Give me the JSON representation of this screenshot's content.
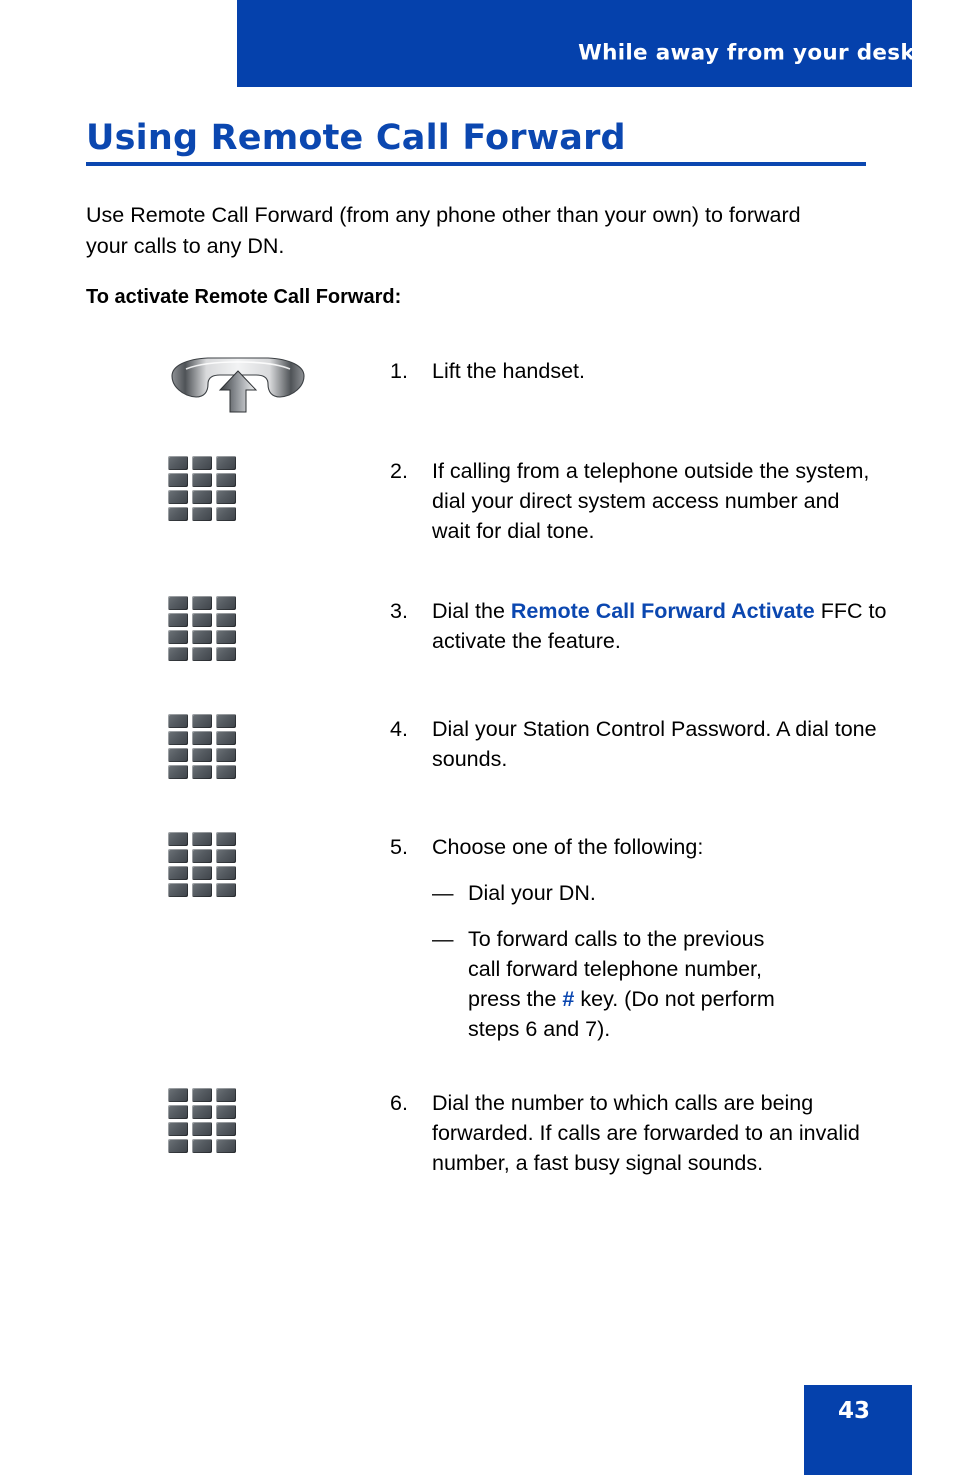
{
  "header": {
    "running_title": "While away from your desk",
    "bar_color": "#0541AC"
  },
  "title": {
    "text": "Using Remote Call Forward",
    "color": "#0B47B0"
  },
  "intro": {
    "paragraph": "Use Remote Call Forward (from any phone other than your own) to forward your calls to any DN.",
    "subheading": "To activate Remote Call Forward:"
  },
  "steps": [
    {
      "number": "1.",
      "icon": "handset-lift-icon",
      "text_before": "Lift the handset.",
      "accent": "",
      "text_after": ""
    },
    {
      "number": "2.",
      "icon": "dial-pad-icon",
      "text_before": "If calling from a telephone outside the system, dial your direct system access number and wait for dial tone.",
      "accent": "",
      "text_after": ""
    },
    {
      "number": "3.",
      "icon": "dial-pad-icon",
      "text_before": "Dial the ",
      "accent": "Remote Call Forward Activate",
      "text_after": " FFC to activate the feature."
    },
    {
      "number": "4.",
      "icon": "dial-pad-icon",
      "text_before": "Dial your Station Control Password. A dial tone sounds.",
      "accent": "",
      "text_after": ""
    },
    {
      "number": "5.",
      "icon": "dial-pad-icon",
      "text_before": "Choose one of the following:",
      "accent": "",
      "text_after": "",
      "sublist": [
        {
          "dash": "—",
          "text_before": "Dial your DN.",
          "accent": "",
          "text_after": ""
        },
        {
          "dash": "—",
          "text_before": "To forward calls to the previous call forward telephone number, press the ",
          "accent": "#",
          "text_after": " key. (Do not perform steps 6 and 7)."
        }
      ]
    },
    {
      "number": "6.",
      "icon": "dial-pad-icon",
      "text_before": "Dial the number to which calls are being forwarded. If calls are forwarded to an invalid number, a fast busy signal sounds.",
      "accent": "",
      "text_after": ""
    }
  ],
  "footer": {
    "page_number": "43",
    "box_color": "#0541AC"
  }
}
